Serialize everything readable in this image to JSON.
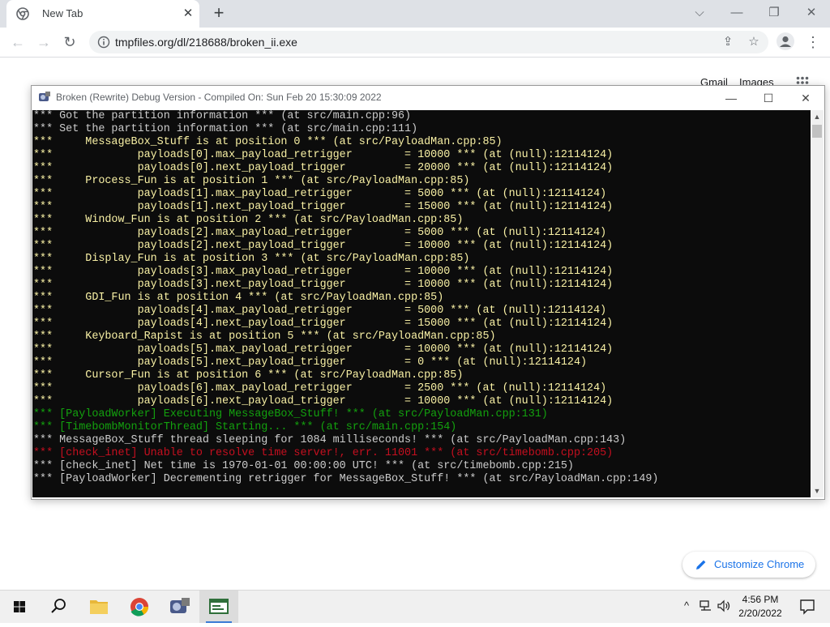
{
  "browser": {
    "tab_title": "New Tab",
    "tab_close_glyph": "✕",
    "new_tab_glyph": "+",
    "url": "tmpfiles.org/dl/218688/broken_ii.exe",
    "window_controls": {
      "dropdown": "⌵",
      "minimize": "—",
      "restore": "❐",
      "close": "✕"
    },
    "links": {
      "gmail": "Gmail",
      "images": "Images"
    },
    "customize_label": "Customize Chrome",
    "accent_color": "#1a73e8"
  },
  "console": {
    "title": "Broken (Rewrite) Debug Version - Compiled On: Sun Feb 20 15:30:09 2022",
    "lines": [
      {
        "color": "white",
        "text": "*** Got the partition information *** (at src/main.cpp:96)"
      },
      {
        "color": "white",
        "text": "*** Set the partition information *** (at src/main.cpp:111)"
      },
      {
        "color": "yellow",
        "text": "***     MessageBox_Stuff is at position 0 *** (at src/PayloadMan.cpp:85)"
      },
      {
        "color": "yellow",
        "text": "***             payloads[0].max_payload_retrigger        = 10000 *** (at (null):12114124)"
      },
      {
        "color": "yellow",
        "text": "***             payloads[0].next_payload_trigger         = 20000 *** (at (null):12114124)"
      },
      {
        "color": "yellow",
        "text": "***     Process_Fun is at position 1 *** (at src/PayloadMan.cpp:85)"
      },
      {
        "color": "yellow",
        "text": "***             payloads[1].max_payload_retrigger        = 5000 *** (at (null):12114124)"
      },
      {
        "color": "yellow",
        "text": "***             payloads[1].next_payload_trigger         = 15000 *** (at (null):12114124)"
      },
      {
        "color": "yellow",
        "text": "***     Window_Fun is at position 2 *** (at src/PayloadMan.cpp:85)"
      },
      {
        "color": "yellow",
        "text": "***             payloads[2].max_payload_retrigger        = 5000 *** (at (null):12114124)"
      },
      {
        "color": "yellow",
        "text": "***             payloads[2].next_payload_trigger         = 10000 *** (at (null):12114124)"
      },
      {
        "color": "yellow",
        "text": "***     Display_Fun is at position 3 *** (at src/PayloadMan.cpp:85)"
      },
      {
        "color": "yellow",
        "text": "***             payloads[3].max_payload_retrigger        = 10000 *** (at (null):12114124)"
      },
      {
        "color": "yellow",
        "text": "***             payloads[3].next_payload_trigger         = 10000 *** (at (null):12114124)"
      },
      {
        "color": "yellow",
        "text": "***     GDI_Fun is at position 4 *** (at src/PayloadMan.cpp:85)"
      },
      {
        "color": "yellow",
        "text": "***             payloads[4].max_payload_retrigger        = 5000 *** (at (null):12114124)"
      },
      {
        "color": "yellow",
        "text": "***             payloads[4].next_payload_trigger         = 15000 *** (at (null):12114124)"
      },
      {
        "color": "yellow",
        "text": "***     Keyboard_Rapist is at position 5 *** (at src/PayloadMan.cpp:85)"
      },
      {
        "color": "yellow",
        "text": "***             payloads[5].max_payload_retrigger        = 10000 *** (at (null):12114124)"
      },
      {
        "color": "yellow",
        "text": "***             payloads[5].next_payload_trigger         = 0 *** (at (null):12114124)"
      },
      {
        "color": "yellow",
        "text": "***     Cursor_Fun is at position 6 *** (at src/PayloadMan.cpp:85)"
      },
      {
        "color": "yellow",
        "text": "***             payloads[6].max_payload_retrigger        = 2500 *** (at (null):12114124)"
      },
      {
        "color": "yellow",
        "text": "***             payloads[6].next_payload_trigger         = 10000 *** (at (null):12114124)"
      },
      {
        "color": "green",
        "text": "*** [PayloadWorker] Executing MessageBox_Stuff! *** (at src/PayloadMan.cpp:131)"
      },
      {
        "color": "green",
        "text": "*** [TimebombMonitorThread] Starting... *** (at src/main.cpp:154)"
      },
      {
        "color": "white",
        "text": "*** MessageBox_Stuff thread sleeping for 1084 milliseconds! *** (at src/PayloadMan.cpp:143)"
      },
      {
        "color": "red",
        "text": "*** [check_inet] Unable to resolve time server!, err. 11001 *** (at src/timebomb.cpp:205)"
      },
      {
        "color": "white",
        "text": "*** [check_inet] Net time is 1970-01-01 00:00:00 UTC! *** (at src/timebomb.cpp:215)"
      },
      {
        "color": "white",
        "text": "*** [PayloadWorker] Decrementing retrigger for MessageBox_Stuff! *** (at src/PayloadMan.cpp:149)"
      }
    ],
    "colors": {
      "white": "#cccccc",
      "yellow": "#f9f1a5",
      "green": "#13a10e",
      "red": "#c50f1f",
      "background": "#0c0c0c"
    }
  },
  "taskbar": {
    "time": "4:56 PM",
    "date": "2/20/2022",
    "apps": [
      "start-icon",
      "search-icon",
      "file-explorer-icon",
      "chrome-icon",
      "broken-app-icon",
      "console-app-icon"
    ]
  }
}
